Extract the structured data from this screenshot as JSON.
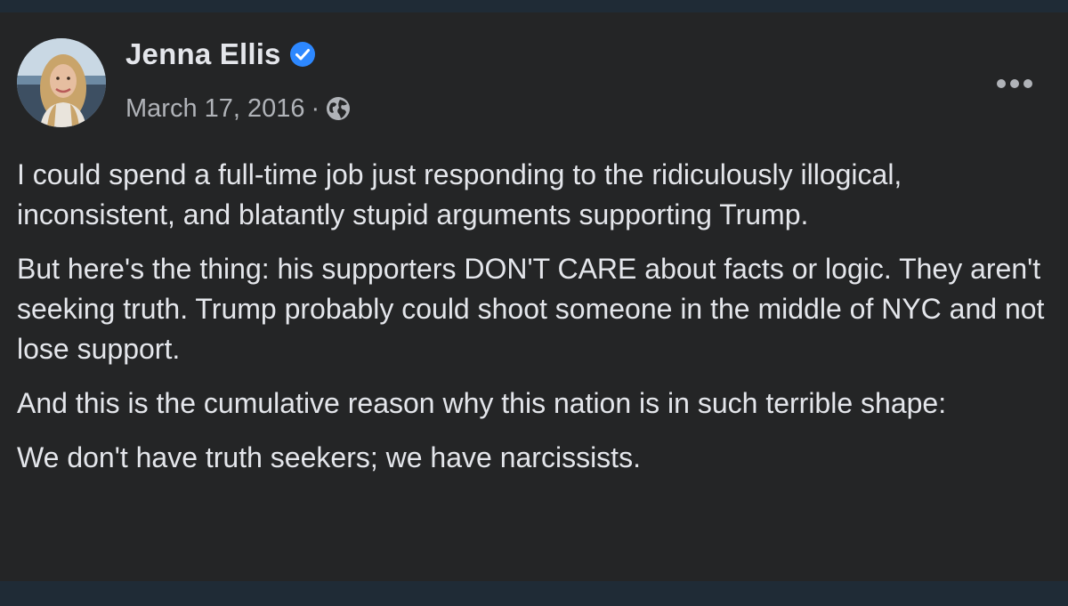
{
  "post": {
    "author": "Jenna Ellis",
    "verified": true,
    "date": "March 17, 2016",
    "separator": "·",
    "privacy_icon": "globe-icon",
    "more_icon": "more-options-icon",
    "paragraphs": [
      "I could spend a full-time job just responding to the ridiculously illogical, inconsistent, and blatantly stupid arguments supporting Trump.",
      "But here's the thing: his supporters DON'T CARE about facts or logic. They aren't seeking truth. Trump probably could shoot someone in the middle of NYC and not lose support.",
      "And this is the cumulative reason why this nation is in such terrible shape:",
      "We don't have truth seekers; we have narcissists."
    ]
  },
  "colors": {
    "card_background": "#242526",
    "outer_background": "#1f2b36",
    "primary_text": "#e4e6eb",
    "secondary_text": "#b0b3b8",
    "verified_badge": "#2d88ff"
  }
}
